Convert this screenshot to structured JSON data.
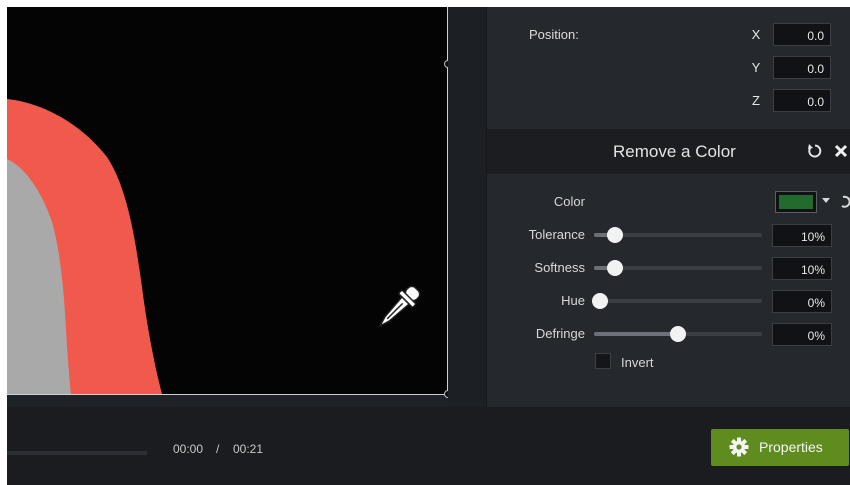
{
  "position": {
    "label": "Position:",
    "axes": [
      {
        "axis": "X",
        "value": "0.0"
      },
      {
        "axis": "Y",
        "value": "0.0"
      },
      {
        "axis": "Z",
        "value": "0.0"
      }
    ]
  },
  "effect": {
    "title": "Remove a Color",
    "color_label": "Color",
    "color_value": "#236b2c",
    "sliders": [
      {
        "label": "Tolerance",
        "value": "10%",
        "level": 0.1
      },
      {
        "label": "Softness",
        "value": "10%",
        "level": 0.1
      },
      {
        "label": "Hue",
        "value": "0%",
        "level": 0.0
      },
      {
        "label": "Defringe",
        "value": "0%",
        "level": 0.5
      }
    ],
    "invert_label": "Invert",
    "invert_checked": false
  },
  "playback": {
    "current": "00:00",
    "separator": "/",
    "total": "00:21"
  },
  "properties_button": {
    "label": "Properties"
  },
  "icons": {
    "eyedropper": "eyedropper-icon",
    "reset": "reset-icon",
    "close": "close-icon",
    "gear": "gear-icon"
  },
  "colors": {
    "accent_green": "#5e8c1f",
    "panel_bg": "#25282d",
    "shirt_red": "#ef5a4c",
    "shirt_gray": "#a9a9a9"
  }
}
